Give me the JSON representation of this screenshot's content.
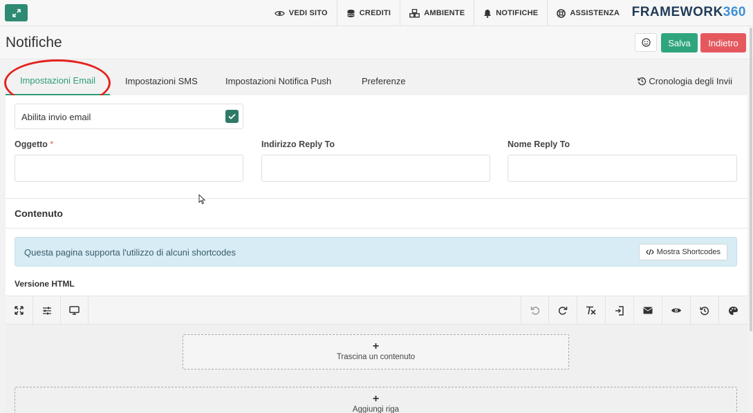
{
  "topbar": {
    "nav": [
      {
        "label": "VEDI SITO",
        "icon": "eye-icon"
      },
      {
        "label": "CREDITI",
        "icon": "coins-icon"
      },
      {
        "label": "AMBIENTE",
        "icon": "cubes-icon"
      },
      {
        "label": "NOTIFICHE",
        "icon": "bell-icon"
      },
      {
        "label": "ASSISTENZA",
        "icon": "lifebuoy-icon"
      }
    ],
    "brand_text": "FRAMEWORK",
    "brand_num": "360"
  },
  "header": {
    "title": "Notifiche",
    "save_label": "Salva",
    "back_label": "Indietro"
  },
  "tabs": {
    "items": [
      {
        "label": "Impostazioni Email",
        "active": true
      },
      {
        "label": "Impostazioni SMS"
      },
      {
        "label": "Impostazioni Notifica Push"
      },
      {
        "label": "Preferenze"
      }
    ],
    "history_label": "Cronologia degli Invii"
  },
  "form": {
    "enable_email_label": "Abilita invio email",
    "enable_email_checked": true,
    "subject_label": "Oggetto",
    "required_mark": "*",
    "reply_to_address_label": "Indirizzo Reply To",
    "reply_to_name_label": "Nome Reply To",
    "subject_value": "",
    "reply_to_address_value": "",
    "reply_to_name_value": ""
  },
  "content": {
    "section_title": "Contenuto",
    "info_text": "Questa pagina supporta l'utilizzo di alcuni shortcodes",
    "shortcodes_button": "Mostra Shortcodes",
    "html_version_label": "Versione HTML"
  },
  "editor": {
    "drop_zone_label": "Trascina un contenuto",
    "add_row_label": "Aggiungi riga"
  },
  "colors": {
    "accent": "#2e9c78",
    "save": "#2fa57e",
    "back": "#e5595e",
    "brand": "#1f3b57",
    "info_bg": "#d7ecf4"
  }
}
